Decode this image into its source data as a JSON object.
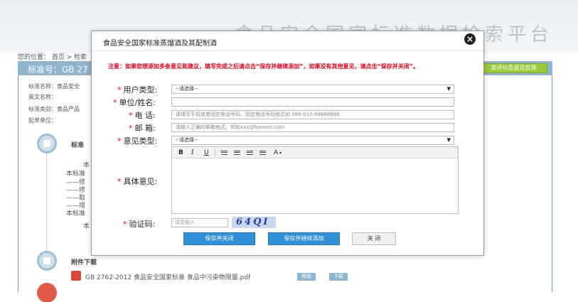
{
  "background": {
    "banner_text": "食品安全国家标准数据检索平台",
    "breadcrumb": "您的位置： 首页 > 检索",
    "title_bar": "标准号：GB 27",
    "green_button": "提评价及意见反馈",
    "info": {
      "name_label": "标准名称：食品安全",
      "english_label": "英文名称：",
      "category_label": "标准类别：食品产品",
      "drafter_label": "起草单位："
    },
    "section_label": "标准",
    "text_lines": [
      "本",
      "本标准",
      "——修",
      "——修",
      "——取",
      "——增",
      "本标准",
      "本"
    ],
    "attachments_label": "附件下载",
    "file_name": "GB 2762-2012 食品安全国家标准 食品中污染物限量.pdf",
    "file_buttons": [
      "预览",
      "下载"
    ]
  },
  "modal": {
    "title": "食品安全国家标准蒸馏酒及其配制酒",
    "notice": "注意：如果您想添加多条意见和建议，填写完成之后请点击“保存并继续添加”，如果没有其他意见，请点击“保存并关闭”。",
    "form": {
      "user_type": {
        "label": "用户类型:",
        "value": "--请选择--"
      },
      "unit_name": {
        "label": "单位/姓名:",
        "value": ""
      },
      "phone": {
        "label": "电    话:",
        "placeholder": "请填写手机或者固定电话号码，固定电话号码格式如 086-010-88888888"
      },
      "email": {
        "label": "邮    箱:",
        "placeholder": "请输入正确的邮箱格式，例如xxx@foxmail.com"
      },
      "opinion_type": {
        "label": "意见类型:",
        "value": "--请选择--"
      },
      "detail": {
        "label": "具体意见:"
      },
      "captcha": {
        "label": "验证码:",
        "placeholder": "请您输入",
        "image_text": "64QI"
      }
    },
    "editor_toolbar": {
      "bold": "B",
      "italic": "I",
      "underline": "U",
      "font_color": "A"
    },
    "buttons": {
      "save_close": "保存并关闭",
      "save_continue": "保存并继续添加",
      "close": "关 闭"
    }
  }
}
